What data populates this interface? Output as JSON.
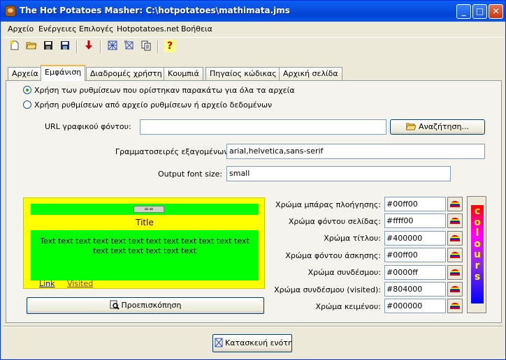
{
  "window": {
    "title": "The Hot Potatoes Masher: C:\\hotpotatoes\\mathimata.jms",
    "minimize": "_",
    "maximize": "□",
    "close": "✕"
  },
  "menu": [
    "Αρχείο",
    "Ενέργειες",
    "Επιλογές",
    "Hotpotatoes.net",
    "Βοήθεια"
  ],
  "toolbar": {
    "icons": [
      "new-file-icon",
      "open-folder-icon",
      "save-icon",
      "save-as-icon",
      "add-arrow-icon",
      "build-icon",
      "build-all-icon",
      "copy-pages-icon",
      "help-icon"
    ],
    "help_glyph": "?"
  },
  "tabs": [
    "Αρχεία",
    "Εμφάνιση",
    "Διαδρομές χρήστη",
    "Κουμπιά",
    "Πηγαίος κώδικας",
    "Αρχική σελίδα"
  ],
  "active_tab": "Εμφάνιση",
  "options": {
    "radio_all": "Χρήση των ρυθμίσεων που ορίστηκαν παρακάτω για όλα τα αρχεία",
    "radio_file": "Χρήση ρυθμίσεων από αρχείο ρυθμίσεων ή αρχείο δεδομένων",
    "selected": "radio_all"
  },
  "fields": {
    "bg_url_label": "URL γραφικού φόντου:",
    "bg_url_value": "",
    "browse_label": "Αναζήτηση...",
    "fonts_label": "Γραμματοσειρές εξαγομένων",
    "fonts_value": "arial,helvetica,sans-serif",
    "font_size_label": "Output font size:",
    "font_size_value": "small"
  },
  "preview": {
    "nav_button": "==",
    "title": "Title",
    "body_text": "Text text text text text text text text text text text text text text text text text text",
    "link": "Link",
    "visited": "Visited",
    "preview_button": "Προεπισκόπηση"
  },
  "colors": [
    {
      "label": "Χρώμα μπάρας πλοήγησης:",
      "value": "#00ff00"
    },
    {
      "label": "Χρώμα φόντου σελίδας:",
      "value": "#ffff00"
    },
    {
      "label": "Χρώμα τίτλου:",
      "value": "#400000"
    },
    {
      "label": "Χρώμα φόντου άσκησης:",
      "value": "#00ff00"
    },
    {
      "label": "Χρώμα συνδέσμου:",
      "value": "#0000ff"
    },
    {
      "label": "Χρώμα συνδέσμου (visited):",
      "value": "#804000"
    },
    {
      "label": "Χρώμα κειμένου:",
      "value": "#000000"
    }
  ],
  "colours_logo": "colours",
  "build_button": "Κατασκευή ενότητ"
}
